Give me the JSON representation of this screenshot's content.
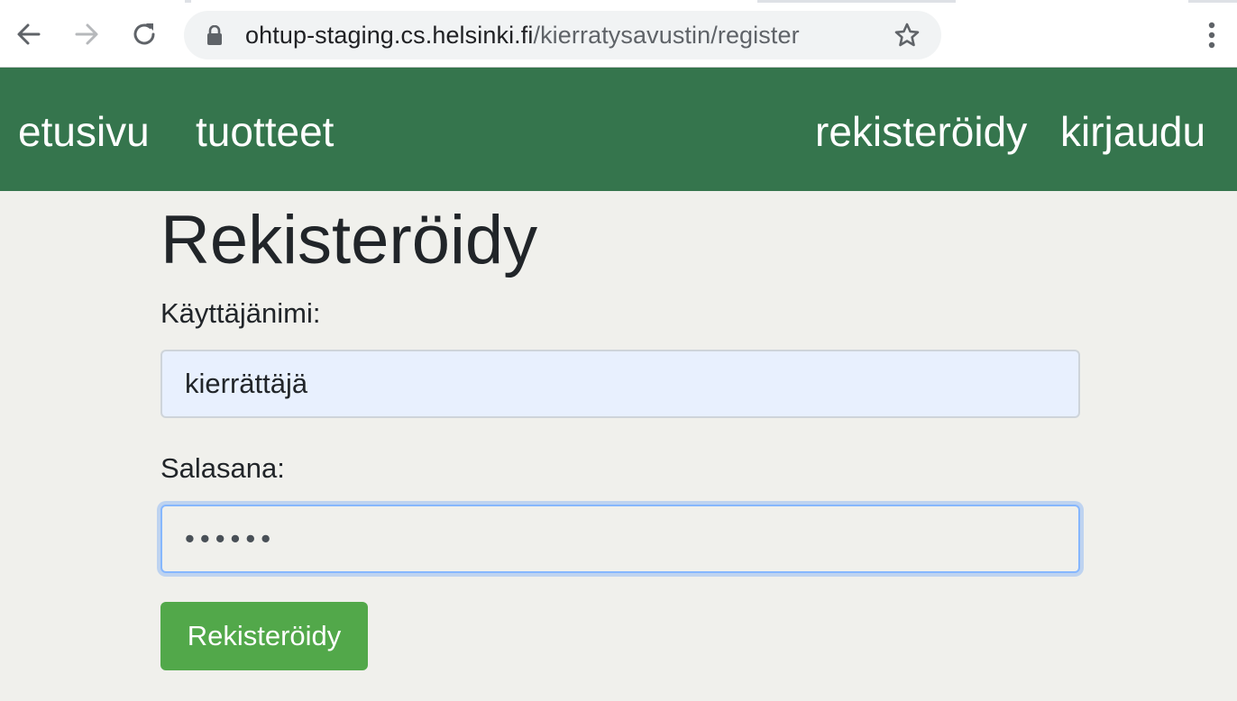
{
  "browser": {
    "url_host": "ohtup-staging.cs.helsinki.fi",
    "url_path": "/kierratysavustin/register",
    "icons": [
      "back-arrow-icon",
      "forward-arrow-icon",
      "reload-icon",
      "lock-icon",
      "star-icon",
      "kebab-menu-icon"
    ]
  },
  "nav": {
    "home": "etusivu",
    "products": "tuotteet",
    "register": "rekisteröidy",
    "login": "kirjaudu"
  },
  "form": {
    "title": "Rekisteröidy",
    "username_label": "Käyttäjänimi:",
    "username_value": "kierrättäjä",
    "password_label": "Salasana:",
    "password_value": "••••••",
    "submit_label": "Rekisteröidy"
  },
  "colors": {
    "nav_background": "#35754d",
    "page_background": "#f0f0ec",
    "submit_button": "#52a84a",
    "autofill_background": "#e8f0fe",
    "focus_border": "#86b7fe"
  }
}
